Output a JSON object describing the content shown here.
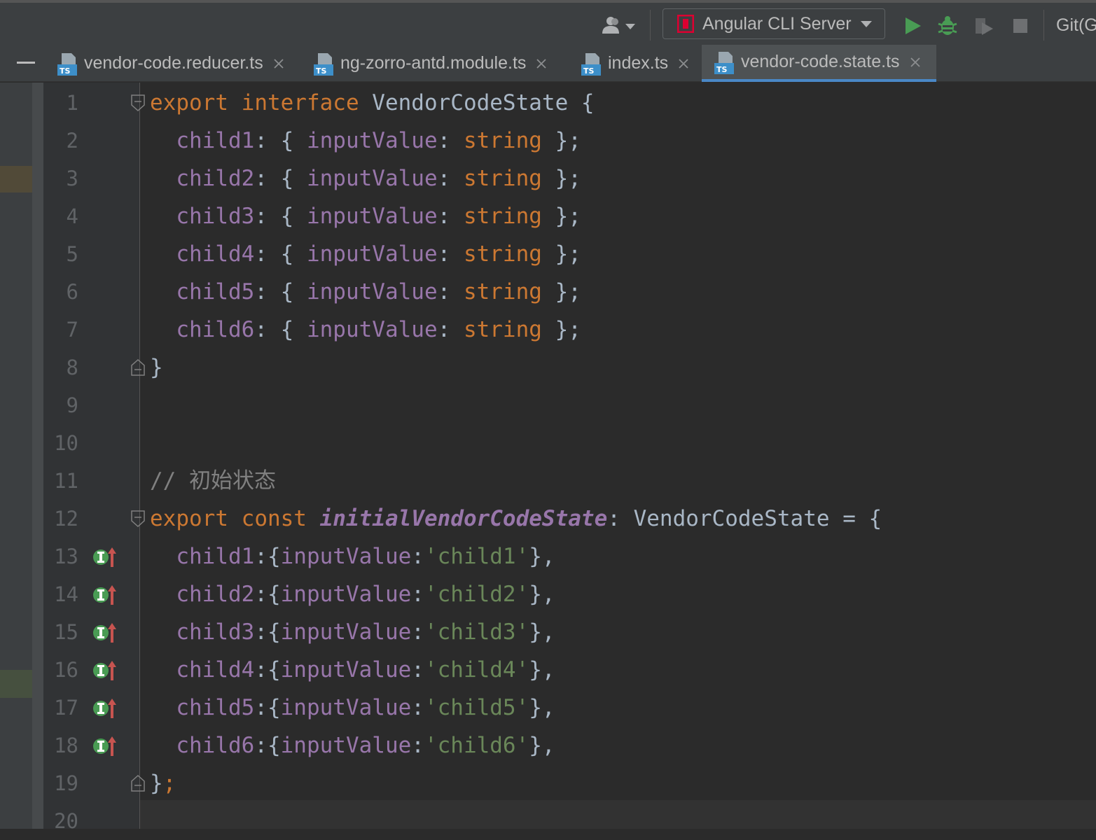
{
  "toolbar": {
    "run_config_label": "Angular CLI Server",
    "git_label": "Git(G",
    "icons": [
      "user-menu-icon",
      "angular-icon",
      "run-icon",
      "debug-icon",
      "coverage-icon",
      "stop-icon"
    ],
    "colors": {
      "run": "#499c54",
      "angular": "#dd0031"
    }
  },
  "tabs": [
    {
      "label": "vendor-code.reducer.ts",
      "active": false
    },
    {
      "label": "ng-zorro-antd.module.ts",
      "active": false
    },
    {
      "label": "index.ts",
      "active": false
    },
    {
      "label": "vendor-code.state.ts",
      "active": true
    }
  ],
  "editor": {
    "line_numbers": [
      "1",
      "2",
      "3",
      "4",
      "5",
      "6",
      "7",
      "8",
      "9",
      "10",
      "11",
      "12",
      "13",
      "14",
      "15",
      "16",
      "17",
      "18",
      "19",
      "20"
    ],
    "lines": [
      [
        {
          "t": "export ",
          "c": "kw"
        },
        {
          "t": "interface ",
          "c": "kw"
        },
        {
          "t": "VendorCodeState {",
          "c": "plain"
        }
      ],
      [
        {
          "t": "  child1",
          "c": "prop"
        },
        {
          "t": ": { ",
          "c": "plain"
        },
        {
          "t": "inputValue",
          "c": "prop"
        },
        {
          "t": ": ",
          "c": "plain"
        },
        {
          "t": "string",
          "c": "kw"
        },
        {
          "t": " };",
          "c": "plain"
        }
      ],
      [
        {
          "t": "  child2",
          "c": "prop"
        },
        {
          "t": ": { ",
          "c": "plain"
        },
        {
          "t": "inputValue",
          "c": "prop"
        },
        {
          "t": ": ",
          "c": "plain"
        },
        {
          "t": "string",
          "c": "kw"
        },
        {
          "t": " };",
          "c": "plain"
        }
      ],
      [
        {
          "t": "  child3",
          "c": "prop"
        },
        {
          "t": ": { ",
          "c": "plain"
        },
        {
          "t": "inputValue",
          "c": "prop"
        },
        {
          "t": ": ",
          "c": "plain"
        },
        {
          "t": "string",
          "c": "kw"
        },
        {
          "t": " };",
          "c": "plain"
        }
      ],
      [
        {
          "t": "  child4",
          "c": "prop"
        },
        {
          "t": ": { ",
          "c": "plain"
        },
        {
          "t": "inputValue",
          "c": "prop"
        },
        {
          "t": ": ",
          "c": "plain"
        },
        {
          "t": "string",
          "c": "kw"
        },
        {
          "t": " };",
          "c": "plain"
        }
      ],
      [
        {
          "t": "  child5",
          "c": "prop"
        },
        {
          "t": ": { ",
          "c": "plain"
        },
        {
          "t": "inputValue",
          "c": "prop"
        },
        {
          "t": ": ",
          "c": "plain"
        },
        {
          "t": "string",
          "c": "kw"
        },
        {
          "t": " };",
          "c": "plain"
        }
      ],
      [
        {
          "t": "  child6",
          "c": "prop"
        },
        {
          "t": ": { ",
          "c": "plain"
        },
        {
          "t": "inputValue",
          "c": "prop"
        },
        {
          "t": ": ",
          "c": "plain"
        },
        {
          "t": "string",
          "c": "kw"
        },
        {
          "t": " };",
          "c": "plain"
        }
      ],
      [
        {
          "t": "}",
          "c": "plain"
        }
      ],
      [],
      [],
      [
        {
          "t": "// 初始状态",
          "c": "cmt"
        }
      ],
      [
        {
          "t": "export ",
          "c": "kw"
        },
        {
          "t": "const ",
          "c": "kw"
        },
        {
          "t": "initialVendorCodeState",
          "c": "ital"
        },
        {
          "t": ": VendorCodeState = {",
          "c": "plain"
        }
      ],
      [
        {
          "t": "  child1",
          "c": "prop"
        },
        {
          "t": ":{",
          "c": "plain"
        },
        {
          "t": "inputValue",
          "c": "prop"
        },
        {
          "t": ":",
          "c": "plain"
        },
        {
          "t": "'child1'",
          "c": "str"
        },
        {
          "t": "},",
          "c": "plain"
        }
      ],
      [
        {
          "t": "  child2",
          "c": "prop"
        },
        {
          "t": ":{",
          "c": "plain"
        },
        {
          "t": "inputValue",
          "c": "prop"
        },
        {
          "t": ":",
          "c": "plain"
        },
        {
          "t": "'child2'",
          "c": "str"
        },
        {
          "t": "},",
          "c": "plain"
        }
      ],
      [
        {
          "t": "  child3",
          "c": "prop"
        },
        {
          "t": ":{",
          "c": "plain"
        },
        {
          "t": "inputValue",
          "c": "prop"
        },
        {
          "t": ":",
          "c": "plain"
        },
        {
          "t": "'child3'",
          "c": "str"
        },
        {
          "t": "},",
          "c": "plain"
        }
      ],
      [
        {
          "t": "  child4",
          "c": "prop"
        },
        {
          "t": ":{",
          "c": "plain"
        },
        {
          "t": "inputValue",
          "c": "prop"
        },
        {
          "t": ":",
          "c": "plain"
        },
        {
          "t": "'child4'",
          "c": "str"
        },
        {
          "t": "},",
          "c": "plain"
        }
      ],
      [
        {
          "t": "  child5",
          "c": "prop"
        },
        {
          "t": ":{",
          "c": "plain"
        },
        {
          "t": "inputValue",
          "c": "prop"
        },
        {
          "t": ":",
          "c": "plain"
        },
        {
          "t": "'child5'",
          "c": "str"
        },
        {
          "t": "},",
          "c": "plain"
        }
      ],
      [
        {
          "t": "  child6",
          "c": "prop"
        },
        {
          "t": ":{",
          "c": "plain"
        },
        {
          "t": "inputValue",
          "c": "prop"
        },
        {
          "t": ":",
          "c": "plain"
        },
        {
          "t": "'child6'",
          "c": "str"
        },
        {
          "t": "},",
          "c": "plain"
        }
      ],
      [
        {
          "t": "}",
          "c": "plain"
        },
        {
          "t": ";",
          "c": "kw"
        }
      ],
      []
    ],
    "syntax_colors": {
      "keyword": "#cc7832",
      "property": "#9876aa",
      "string": "#6a8759",
      "comment": "#808080",
      "text": "#a9b7c6"
    },
    "fold_marker_lines": [
      1,
      8,
      12,
      19
    ],
    "implements_marker_lines": [
      13,
      14,
      15,
      16,
      17,
      18
    ]
  }
}
